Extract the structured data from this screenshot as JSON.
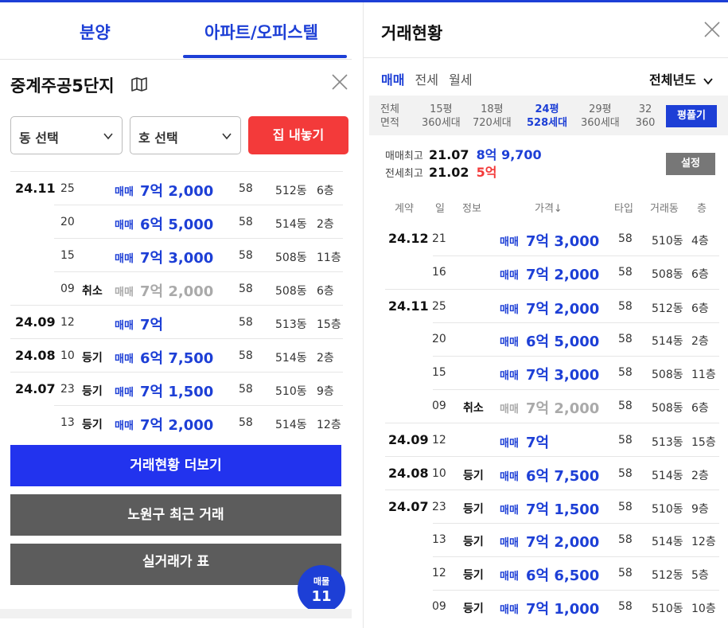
{
  "tabs": {
    "bunyang": "분양",
    "apt": "아파트/오피스텔"
  },
  "apartment": {
    "name": "중계주공5단지"
  },
  "selects": {
    "dong": "동 선택",
    "ho": "호 선택",
    "list_button": "집 내놓기"
  },
  "left_rows": [
    {
      "month": "24.11",
      "day": "25",
      "info": "",
      "kind": "매매",
      "price": "7억 2,000",
      "type": "58",
      "dong": "512동",
      "floor": "6층",
      "cancel": false
    },
    {
      "month": "",
      "day": "20",
      "info": "",
      "kind": "매매",
      "price": "6억 5,000",
      "type": "58",
      "dong": "514동",
      "floor": "2층",
      "cancel": false
    },
    {
      "month": "",
      "day": "15",
      "info": "",
      "kind": "매매",
      "price": "7억 3,000",
      "type": "58",
      "dong": "508동",
      "floor": "11층",
      "cancel": false
    },
    {
      "month": "",
      "day": "09",
      "info": "취소",
      "kind": "매매",
      "price": "7억 2,000",
      "type": "58",
      "dong": "508동",
      "floor": "6층",
      "cancel": true
    },
    {
      "month": "24.09",
      "day": "12",
      "info": "",
      "kind": "매매",
      "price": "7억",
      "type": "58",
      "dong": "513동",
      "floor": "15층",
      "cancel": false
    },
    {
      "month": "24.08",
      "day": "10",
      "info": "등기",
      "kind": "매매",
      "price": "6억 7,500",
      "type": "58",
      "dong": "514동",
      "floor": "2층",
      "cancel": false
    },
    {
      "month": "24.07",
      "day": "23",
      "info": "등기",
      "kind": "매매",
      "price": "7억 1,500",
      "type": "58",
      "dong": "510동",
      "floor": "9층",
      "cancel": false
    },
    {
      "month": "",
      "day": "13",
      "info": "등기",
      "kind": "매매",
      "price": "7억 2,000",
      "type": "58",
      "dong": "514동",
      "floor": "12층",
      "cancel": false
    }
  ],
  "buttons": {
    "more": "거래현황 더보기",
    "recent": "노원구 최근 거래",
    "table": "실거래가 표"
  },
  "badge": {
    "label": "매물",
    "count": "11"
  },
  "right": {
    "title": "거래현황",
    "deal_tabs": [
      "매매",
      "전세",
      "월세"
    ],
    "year_select": "전체년도",
    "areas": [
      {
        "top": "전체",
        "bottom": "면적",
        "active": false
      },
      {
        "top": "15평",
        "bottom": "360세대",
        "active": false
      },
      {
        "top": "18평",
        "bottom": "720세대",
        "active": false
      },
      {
        "top": "24평",
        "bottom": "528세대",
        "active": true
      },
      {
        "top": "29평",
        "bottom": "360세대",
        "active": false
      },
      {
        "top": "32",
        "bottom": "360",
        "active": false
      }
    ],
    "pyeong_button": "평풀기",
    "max_sale": {
      "label": "매매최고",
      "date": "21.07",
      "price": "8억 9,700"
    },
    "max_jeonse": {
      "label": "전세최고",
      "date": "21.02",
      "price": "5억"
    },
    "settings_button": "설정",
    "columns": [
      "계약",
      "일",
      "정보",
      "가격↓",
      "타입",
      "거래동",
      "층"
    ],
    "rows": [
      {
        "month": "24.12",
        "day": "21",
        "info": "",
        "kind": "매매",
        "price": "7억 3,000",
        "type": "58",
        "dong": "510동",
        "floor": "4층",
        "cancel": false
      },
      {
        "month": "",
        "day": "16",
        "info": "",
        "kind": "매매",
        "price": "7억 2,000",
        "type": "58",
        "dong": "508동",
        "floor": "6층",
        "cancel": false
      },
      {
        "month": "24.11",
        "day": "25",
        "info": "",
        "kind": "매매",
        "price": "7억 2,000",
        "type": "58",
        "dong": "512동",
        "floor": "6층",
        "cancel": false
      },
      {
        "month": "",
        "day": "20",
        "info": "",
        "kind": "매매",
        "price": "6억 5,000",
        "type": "58",
        "dong": "514동",
        "floor": "2층",
        "cancel": false
      },
      {
        "month": "",
        "day": "15",
        "info": "",
        "kind": "매매",
        "price": "7억 3,000",
        "type": "58",
        "dong": "508동",
        "floor": "11층",
        "cancel": false
      },
      {
        "month": "",
        "day": "09",
        "info": "취소",
        "kind": "매매",
        "price": "7억 2,000",
        "type": "58",
        "dong": "508동",
        "floor": "6층",
        "cancel": true
      },
      {
        "month": "24.09",
        "day": "12",
        "info": "",
        "kind": "매매",
        "price": "7억",
        "type": "58",
        "dong": "513동",
        "floor": "15층",
        "cancel": false
      },
      {
        "month": "24.08",
        "day": "10",
        "info": "등기",
        "kind": "매매",
        "price": "6억 7,500",
        "type": "58",
        "dong": "514동",
        "floor": "2층",
        "cancel": false
      },
      {
        "month": "24.07",
        "day": "23",
        "info": "등기",
        "kind": "매매",
        "price": "7억 1,500",
        "type": "58",
        "dong": "510동",
        "floor": "9층",
        "cancel": false
      },
      {
        "month": "",
        "day": "13",
        "info": "등기",
        "kind": "매매",
        "price": "7억 2,000",
        "type": "58",
        "dong": "514동",
        "floor": "12층",
        "cancel": false
      },
      {
        "month": "",
        "day": "12",
        "info": "등기",
        "kind": "매매",
        "price": "6억 6,500",
        "type": "58",
        "dong": "512동",
        "floor": "5층",
        "cancel": false
      },
      {
        "month": "",
        "day": "09",
        "info": "등기",
        "kind": "매매",
        "price": "7억 1,000",
        "type": "58",
        "dong": "510동",
        "floor": "10층",
        "cancel": false
      }
    ]
  },
  "colors": {
    "accent": "#1d3fd6",
    "red": "#f33a3a",
    "gray_button": "#5c5c5c"
  },
  "icons": [
    "map-icon",
    "close-icon",
    "chevron-down-icon"
  ]
}
